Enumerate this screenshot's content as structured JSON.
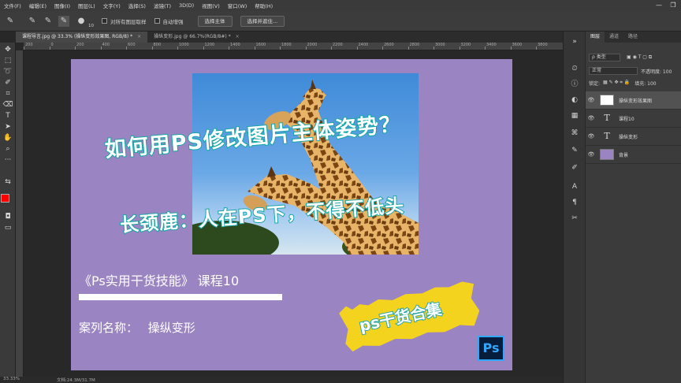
{
  "menu": [
    "文件(F)",
    "编辑(E)",
    "图像(I)",
    "图层(L)",
    "文字(Y)",
    "选择(S)",
    "滤镜(T)",
    "3D(D)",
    "视图(V)",
    "窗口(W)",
    "帮助(H)"
  ],
  "window_controls": {
    "minimize": "—",
    "restore": "❐"
  },
  "options": {
    "brush_size": "10",
    "sample_all_layers": "对所有图层取样",
    "auto_enhance": "自动增强",
    "select_subject": "选择主体",
    "select_and_mask": "选择并遮住..."
  },
  "tabs": [
    {
      "label": "课程导言.jpg @ 33.3% (操纵变形效果图, RGB/8) *",
      "close": "×"
    },
    {
      "label": "操纵变形.jpg @ 66.7%(RGB/8#) *",
      "close": "×"
    }
  ],
  "ruler_ticks": [
    "200",
    "0",
    "200",
    "400",
    "600",
    "800",
    "1000",
    "1200",
    "1400",
    "1600",
    "1800",
    "2000",
    "2200",
    "2400",
    "2600",
    "2800",
    "3000",
    "3200",
    "3400",
    "3600",
    "3800"
  ],
  "canvas": {
    "headline1": "如何用PS修改图片主体姿势？",
    "headline2": "长颈鹿：人在PS下，不得不低头",
    "course_title": "《Ps实用干货技能》 课程10",
    "case_label": "案列名称：",
    "case_name": "操纵变形",
    "stamp": "ps干货合集",
    "logo": "Ps"
  },
  "panel": {
    "tabs": [
      "图层",
      "通道",
      "路径"
    ],
    "filter_kind": "ρ 类型",
    "blend_mode": "正常",
    "opacity_label": "不透明度: 100",
    "lock_label": "锁定:",
    "fill_label": "填充: 100",
    "layers": [
      {
        "name": "操纵变形效果图",
        "kind": "smart"
      },
      {
        "name": "课程10",
        "kind": "text"
      },
      {
        "name": "操纵变形",
        "kind": "text"
      },
      {
        "name": "背景",
        "kind": "background"
      }
    ]
  },
  "status": {
    "zoom": "33.33%",
    "doc": "文档:24.3M/31.7M"
  },
  "colors": {
    "artboard": "#9b84c2",
    "headline_stroke": "#14a6a6",
    "stamp": "#f4d31e",
    "fg": "#ff0000",
    "bg": "#000000"
  }
}
